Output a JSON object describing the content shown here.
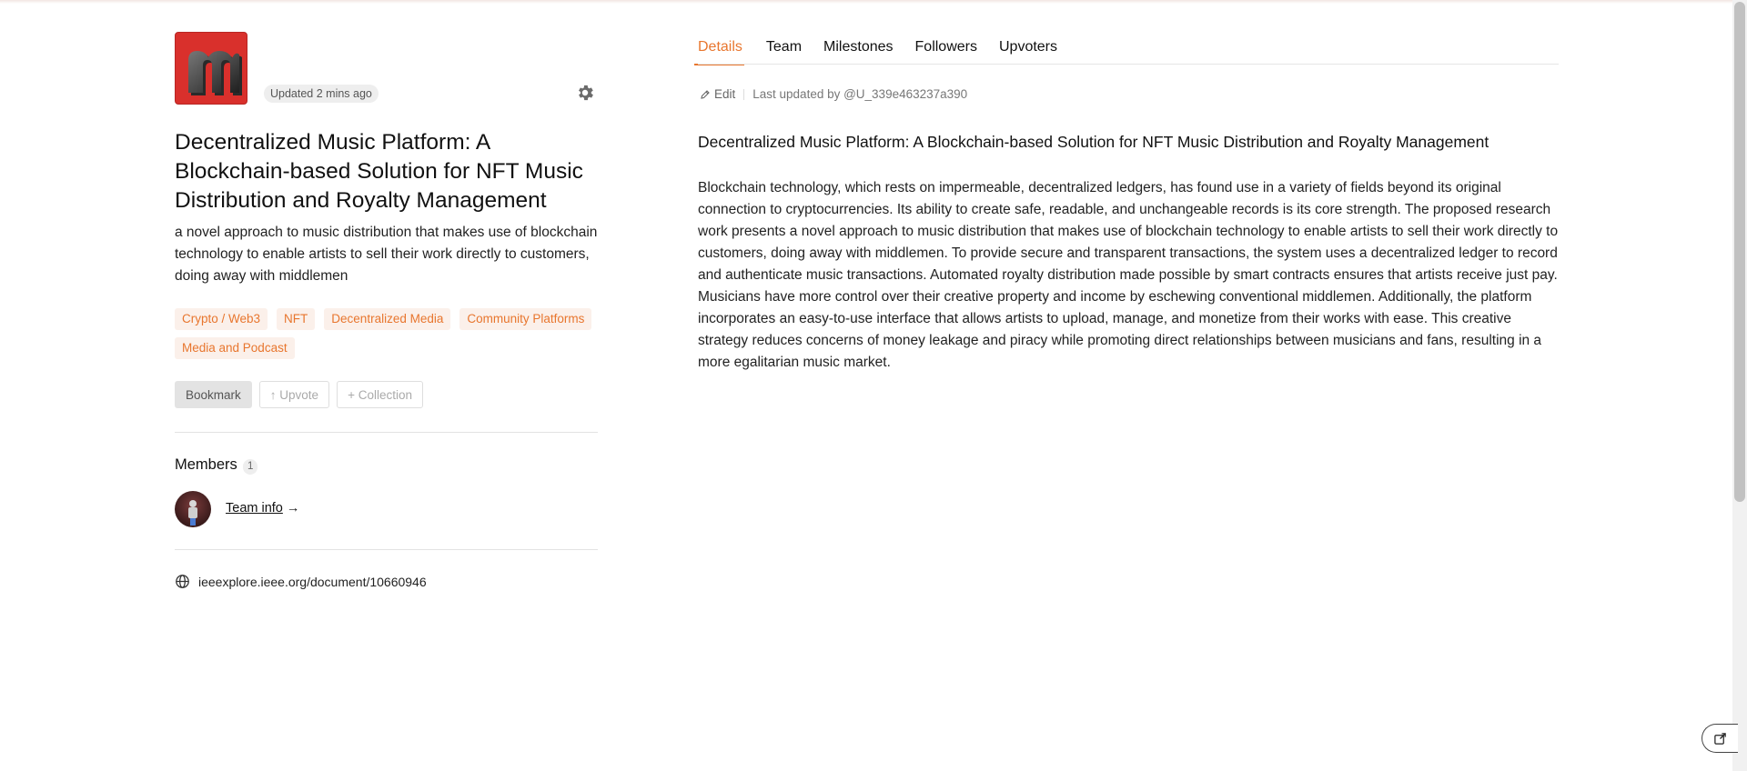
{
  "project": {
    "logo_alt": "m",
    "updated": "Updated 2 mins ago",
    "title": "Decentralized Music Platform: A Blockchain-based Solution for NFT Music Distribution and Royalty Management",
    "subtitle": "a novel approach to music distribution that makes use of blockchain technology to enable artists to sell their work directly to customers, doing away with middlemen",
    "tags": [
      "Crypto / Web3",
      "NFT",
      "Decentralized Media",
      "Community Platforms",
      "Media and Podcast"
    ],
    "actions": {
      "bookmark": "Bookmark",
      "upvote": "↑ Upvote",
      "collection": "+ Collection"
    },
    "members": {
      "title": "Members",
      "count": "1",
      "team_info": "Team info",
      "arrow": "→"
    },
    "website": "ieeexplore.ieee.org/document/10660946"
  },
  "tabs": [
    {
      "label": "Details",
      "active": true
    },
    {
      "label": "Team",
      "active": false
    },
    {
      "label": "Milestones",
      "active": false
    },
    {
      "label": "Followers",
      "active": false
    },
    {
      "label": "Upvoters",
      "active": false
    }
  ],
  "details": {
    "edit_label": "Edit",
    "last_updated": "Last updated by @U_339e463237a390",
    "heading": "Decentralized Music Platform: A Blockchain-based Solution for NFT Music Distribution and Royalty Management",
    "body": "Blockchain technology, which rests on impermeable, decentralized ledgers, has found use in a variety of fields beyond its original connection to cryptocurrencies. Its ability to create safe, readable, and unchangeable records is its core strength. The proposed research work presents a novel approach to music distribution that makes use of blockchain technology to enable artists to sell their work directly to customers, doing away with middlemen. To provide secure and transparent transactions, the system uses a decentralized ledger to record and authenticate music transactions. Automated royalty distribution made possible by smart contracts ensures that artists receive just pay. Musicians have more control over their creative property and income by eschewing conventional middlemen. Additionally, the platform incorporates an easy-to-use interface that allows artists to upload, manage, and monetize from their works with ease. This creative strategy reduces concerns of money leakage and piracy while promoting direct relationships between musicians and fans, resulting in a more egalitarian music market."
  },
  "colors": {
    "accent": "#e8762e",
    "tag_bg": "#fbf0ea",
    "logo_bg": "#d9302c"
  },
  "icons": {
    "settings": "gear-icon",
    "website": "globe-icon",
    "edit": "pencil-icon",
    "share": "share-icon"
  }
}
